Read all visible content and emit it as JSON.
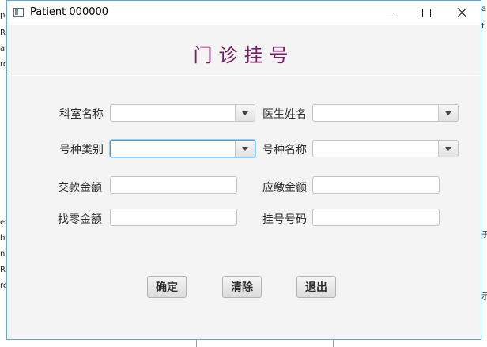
{
  "window": {
    "title": "Patient 000000"
  },
  "header": {
    "heading": "门诊挂号"
  },
  "form": {
    "department_label": "科室名称",
    "doctor_label": "医生姓名",
    "type_label": "号种类别",
    "type_name_label": "号种名称",
    "payment_label": "交款金额",
    "due_label": "应缴金额",
    "change_label": "找零金额",
    "reg_number_label": "挂号号码",
    "department_value": "",
    "doctor_value": "",
    "type_value": "",
    "type_name_value": "",
    "payment_value": "",
    "due_value": "",
    "change_value": "",
    "reg_number_value": ""
  },
  "buttons": {
    "confirm": "确定",
    "clear": "清除",
    "exit": "退出"
  },
  "background": {
    "left_fragments": [
      "pi",
      "R",
      "av",
      "ro",
      "",
      "e",
      "b",
      "n",
      "R",
      "ro"
    ],
    "right_fragments": [
      "a",
      "t",
      "",
      "子",
      "",
      "示"
    ]
  },
  "colors": {
    "heading": "#7a1b63",
    "focus_border": "#3f9ed8",
    "window_border": "#5ea9d6"
  }
}
